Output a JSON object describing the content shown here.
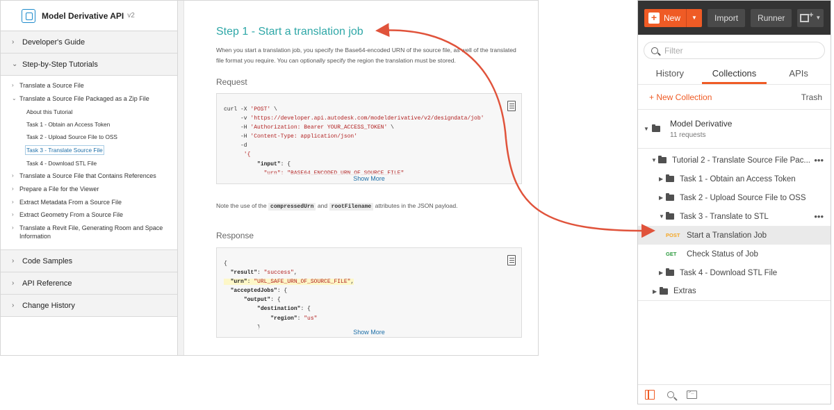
{
  "docs": {
    "brand": {
      "title": "Model Derivative API",
      "version": "v2"
    },
    "sections_top": [
      {
        "label": "Developer's Guide",
        "chevron": "›"
      },
      {
        "label": "Step-by-Step Tutorials",
        "chevron": "⌄"
      }
    ],
    "tutorials": [
      {
        "label": "Translate a Source File",
        "chevron": "›"
      },
      {
        "label": "Translate a Source File Packaged as a Zip File",
        "chevron": "⌄"
      },
      {
        "label": "About this Tutorial"
      },
      {
        "label": "Task 1 - Obtain an Access Token"
      },
      {
        "label": "Task 2 - Upload Source File to OSS"
      },
      {
        "label": "Task 3 - Translate Source File"
      },
      {
        "label": "Task 4 - Download STL File"
      },
      {
        "label": "Translate a Source File that Contains References",
        "chevron": "›"
      },
      {
        "label": "Prepare a File for the Viewer",
        "chevron": "›"
      },
      {
        "label": "Extract Metadata From a Source File",
        "chevron": "›"
      },
      {
        "label": "Extract Geometry From a Source File",
        "chevron": "›"
      },
      {
        "label": "Translate a Revit File, Generating Room and Space Information",
        "chevron": "›"
      }
    ],
    "sections_bottom": [
      {
        "label": "Code Samples",
        "chevron": "›"
      },
      {
        "label": "API Reference",
        "chevron": "›"
      },
      {
        "label": "Change History",
        "chevron": "›"
      }
    ],
    "main": {
      "heading": "Step 1 - Start a translation job",
      "intro": "When you start a translation job, you specify the Base64-encoded URN of the source file, as well of the translated file format you require. You can optionally specify the region the translation must be stored.",
      "request_heading": "Request",
      "request_code": {
        "l1a": "curl -X ",
        "l1b": "'POST'",
        "l1c": " \\",
        "l2a": "     -v ",
        "l2b": "'https://developer.api.autodesk.com/modelderivative/v2/designdata/job'",
        "l3a": "     -H ",
        "l3b": "'Authorization: Bearer YOUR_ACCESS_TOKEN'",
        "l3c": " \\",
        "l4a": "     -H ",
        "l4b": "'Content-Type: application/json'",
        "l5": "     -d",
        "l6": "      '{",
        "l7a": "          ",
        "l7b": "\"input\"",
        "l7c": ": {",
        "l8": "            \"urn\": \"BASE64_ENCODED_URN_OF_SOURCE_FILE\""
      },
      "show_more": "Show More",
      "note_prefix": "Note the use of the",
      "note_code1": "compressedUrn",
      "note_and": "and",
      "note_code2": "rootFilename",
      "note_suffix": "attributes in the JSON payload.",
      "response_heading": "Response",
      "response_code": {
        "l1": "{",
        "l2a": "  ",
        "l2b": "\"result\"",
        "l2c": ": ",
        "l2d": "\"success\"",
        "l2e": ",",
        "l3a": "  ",
        "l3b": "\"urn\"",
        "l3c": ": ",
        "l3d": "\"URL_SAFE_URN_OF_SOURCE_FILE\"",
        "l3e": ",",
        "l4a": "  ",
        "l4b": "\"acceptedJobs\"",
        "l4c": ": {",
        "l5a": "      ",
        "l5b": "\"output\"",
        "l5c": ": {",
        "l6a": "          ",
        "l6b": "\"destination\"",
        "l6c": ": {",
        "l7a": "              ",
        "l7b": "\"region\"",
        "l7c": ": ",
        "l7d": "\"us\"",
        "l8": "          }"
      }
    }
  },
  "postman": {
    "new_label": "New",
    "import_label": "Import",
    "runner_label": "Runner",
    "search_placeholder": "Filter",
    "tabs": [
      "History",
      "Collections",
      "APIs"
    ],
    "new_collection": "+ New Collection",
    "trash": "Trash",
    "collection": {
      "name": "Model Derivative",
      "count": "11 requests"
    },
    "tree": [
      {
        "label": "Tutorial 2 - Translate Source File Pac...",
        "caret": "▼"
      },
      {
        "label": "Task 1 - Obtain an Access Token",
        "caret": "▶"
      },
      {
        "label": "Task 2 - Upload Source File to OSS",
        "caret": "▶"
      },
      {
        "label": "Task 3 - Translate to STL",
        "caret": "▼"
      },
      {
        "method": "POST",
        "label": "Start a Translation Job"
      },
      {
        "method": "GET",
        "label": "Check Status of Job"
      },
      {
        "label": "Task 4 - Download STL File",
        "caret": "▶"
      },
      {
        "label": "Extras",
        "caret": "▶"
      }
    ],
    "more_dots": "•••"
  },
  "colors": {
    "accent": "#ef5b25",
    "heading": "#2ea7a7",
    "link": "#1e6fa8",
    "arrow": "#e0533b"
  }
}
